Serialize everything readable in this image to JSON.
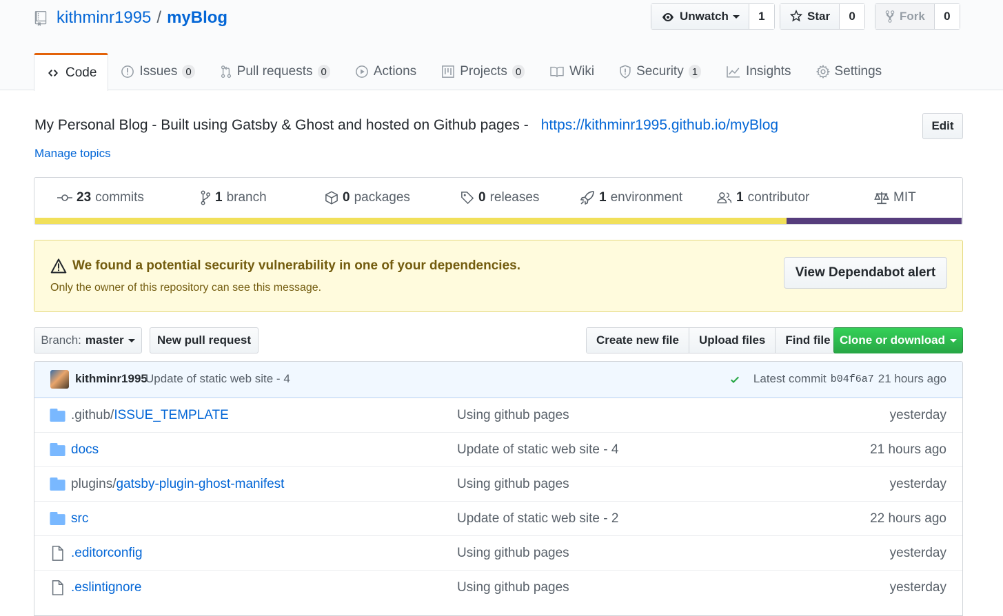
{
  "repo": {
    "owner": "kithminr1995",
    "separator": "/",
    "name": "myBlog"
  },
  "social": {
    "watch": {
      "label": "Unwatch",
      "count": "1"
    },
    "star": {
      "label": "Star",
      "count": "0"
    },
    "fork": {
      "label": "Fork",
      "count": "0"
    }
  },
  "tabs": [
    {
      "label": "Code",
      "icon": "code-icon",
      "active": true
    },
    {
      "label": "Issues",
      "icon": "issue-icon",
      "count": "0"
    },
    {
      "label": "Pull requests",
      "icon": "pull-request-icon",
      "count": "0"
    },
    {
      "label": "Actions",
      "icon": "play-icon"
    },
    {
      "label": "Projects",
      "icon": "project-icon",
      "count": "0"
    },
    {
      "label": "Wiki",
      "icon": "book-icon"
    },
    {
      "label": "Security",
      "icon": "shield-icon",
      "count": "1"
    },
    {
      "label": "Insights",
      "icon": "graph-icon"
    },
    {
      "label": "Settings",
      "icon": "gear-icon"
    }
  ],
  "description": {
    "text": "My Personal Blog - Built using Gatsby & Ghost and hosted on Github pages -",
    "url": "https://kithminr1995.github.io/myBlog",
    "edit_label": "Edit",
    "manage_topics": "Manage topics"
  },
  "summary": {
    "commits": {
      "count": "23",
      "label": "commits"
    },
    "branch": {
      "count": "1",
      "label": "branch"
    },
    "packages": {
      "count": "0",
      "label": "packages"
    },
    "releases": {
      "count": "0",
      "label": "releases"
    },
    "environment": {
      "count": "1",
      "label": "environment"
    },
    "contributor": {
      "count": "1",
      "label": "contributor"
    },
    "license": "MIT",
    "languages": [
      {
        "color": "#f1e05a",
        "percent": 81.1
      },
      {
        "color": "#563d7c",
        "percent": 18.9
      }
    ]
  },
  "alert": {
    "title": "We found a potential security vulnerability in one of your dependencies.",
    "subtitle": "Only the owner of this repository can see this message.",
    "button": "View Dependabot alert"
  },
  "toolbar": {
    "branch_prefix": "Branch:",
    "branch_name": "master",
    "new_pr": "New pull request",
    "create_file": "Create new file",
    "upload_files": "Upload files",
    "find_file": "Find file",
    "clone": "Clone or download"
  },
  "commit": {
    "author": "kithminr1995",
    "message": "Update of static web site - 4",
    "latest_label": "Latest commit",
    "sha": "b04f6a7",
    "age": "21 hours ago"
  },
  "files": [
    {
      "type": "dir",
      "prefix": ".github/",
      "name": "ISSUE_TEMPLATE",
      "message": "Using github pages",
      "age": "yesterday"
    },
    {
      "type": "dir",
      "prefix": "",
      "name": "docs",
      "message": "Update of static web site - 4",
      "age": "21 hours ago"
    },
    {
      "type": "dir",
      "prefix": "plugins/",
      "name": "gatsby-plugin-ghost-manifest",
      "message": "Using github pages",
      "age": "yesterday"
    },
    {
      "type": "dir",
      "prefix": "",
      "name": "src",
      "message": "Update of static web site - 2",
      "age": "22 hours ago"
    },
    {
      "type": "file",
      "prefix": "",
      "name": ".editorconfig",
      "message": "Using github pages",
      "age": "yesterday"
    },
    {
      "type": "file",
      "prefix": "",
      "name": ".eslintignore",
      "message": "Using github pages",
      "age": "yesterday"
    }
  ]
}
